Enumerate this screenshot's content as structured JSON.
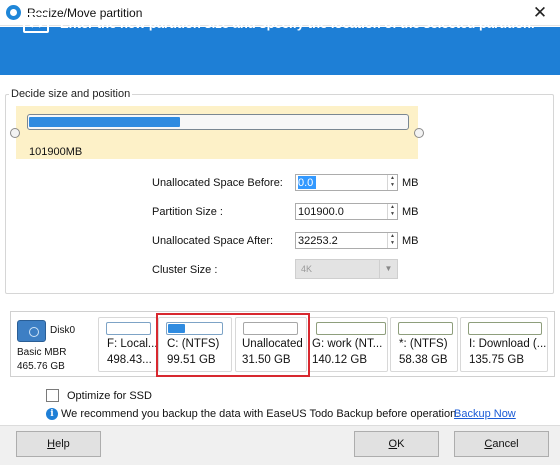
{
  "window": {
    "title": "Resize/Move partition",
    "close_glyph": "✕",
    "app_icon": "easeus-logo-icon"
  },
  "banner": {
    "icon": "resize-arrows-icon",
    "text": "Enter the new partition size and specify the location of the selected partition."
  },
  "group": {
    "title": "Decide size and position"
  },
  "partition_map": {
    "size_label": "101900MB",
    "used_fraction": 0.4
  },
  "fields": {
    "before_label": "Unallocated Space Before:",
    "before_value": "0.0",
    "size_label": "Partition Size :",
    "size_value": "101900.0",
    "after_label": "Unallocated Space After:",
    "after_value": "32253.2",
    "unit": "MB",
    "cluster_label": "Cluster Size :",
    "cluster_value": "4K"
  },
  "disk": {
    "name": "Disk0",
    "type": "Basic MBR",
    "size": "465.76 GB",
    "icon": "hard-disk-icon",
    "partitions": [
      {
        "name": "F: Local...",
        "size": "498.43...",
        "fill": 0.0,
        "bar": "blue"
      },
      {
        "name": "C: (NTFS)",
        "size": "99.51 GB",
        "fill": 0.32,
        "bar": "blue"
      },
      {
        "name": "Unallocated",
        "size": "31.50 GB",
        "fill": 0.0,
        "bar": "gray"
      },
      {
        "name": "G: work (NT...",
        "size": "140.12 GB",
        "fill": 0.0,
        "bar": "green"
      },
      {
        "name": "*: (NTFS)",
        "size": "58.38 GB",
        "fill": 0.0,
        "bar": "green"
      },
      {
        "name": "I: Download (...",
        "size": "135.75 GB",
        "fill": 0.0,
        "bar": "green"
      }
    ]
  },
  "options": {
    "ssd_label": "Optimize for SSD",
    "ssd_checked": false,
    "info_icon": "info-icon",
    "info_text": "We recommend you backup the data with EaseUS Todo Backup before operation.",
    "info_link": "Backup Now"
  },
  "buttons": {
    "help_first": "H",
    "help_rest": "elp",
    "ok_first": "O",
    "ok_rest": "K",
    "cancel_first": "C",
    "cancel_rest": "ancel"
  },
  "colors": {
    "accent": "#1e7fd6",
    "selection_box": "#d8282f",
    "partition_area": "#fdf1c8"
  }
}
